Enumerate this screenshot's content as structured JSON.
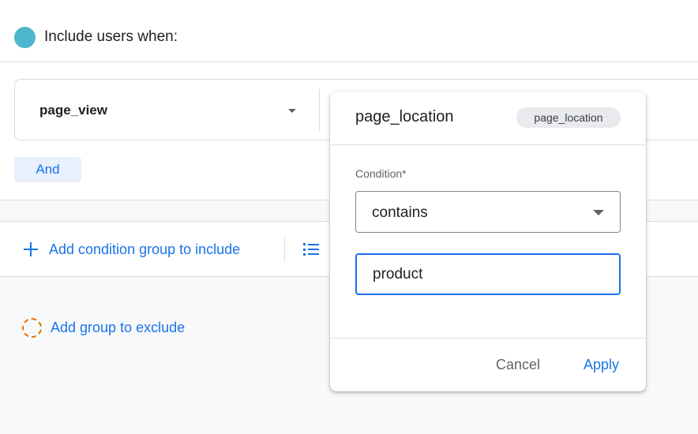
{
  "header": {
    "title": "Include users when:",
    "dot_color": "#4db6cc"
  },
  "condition_row": {
    "event": "page_view",
    "logic_chip": "And"
  },
  "actions": {
    "add_include": "Add condition group to include",
    "add_exclude": "Add group to exclude"
  },
  "popover": {
    "title": "page_location",
    "chip": "page_location",
    "condition_label": "Condition*",
    "condition_value": "contains",
    "input_value": "product",
    "cancel_label": "Cancel",
    "apply_label": "Apply"
  },
  "colors": {
    "accent": "#1a73e8",
    "exclude": "#e37400"
  }
}
